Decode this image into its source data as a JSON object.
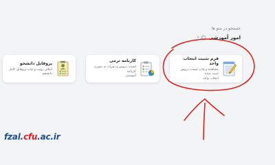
{
  "search": {
    "placeholder": "جستجو در منو ها"
  },
  "breadcrumb": {
    "label": "امور آموزشی",
    "icon": "gear-icon",
    "chevron": "chevron-left-icon"
  },
  "cards": [
    {
      "title": "فرم تثبیت انتخاب واحد",
      "desc_line1": "مشاهده و چاپ لیست دروس تثبیت شده",
      "desc_line2": "انتخاب واحد",
      "icon": "notepad-pencil-icon"
    },
    {
      "title": "کارنامه ترمی",
      "desc_line1": "لیست دروس و نمرات به صورت کارنامه",
      "desc_line2": "آموزشی",
      "icon": "clipboard-chart-icon"
    },
    {
      "title": "پروفایل دانشجو",
      "desc_line1": "امکان رویت و چاپ پروفایل کامل دانشجو",
      "desc_line2": "",
      "icon": "profile-checklist-icon"
    }
  ],
  "annotation": {
    "color": "#e0201b"
  },
  "watermark": {
    "text": "fzal.cfu.ac.ir",
    "brand_blue": "#1f4e8c",
    "brand_red": "#d81e26"
  }
}
